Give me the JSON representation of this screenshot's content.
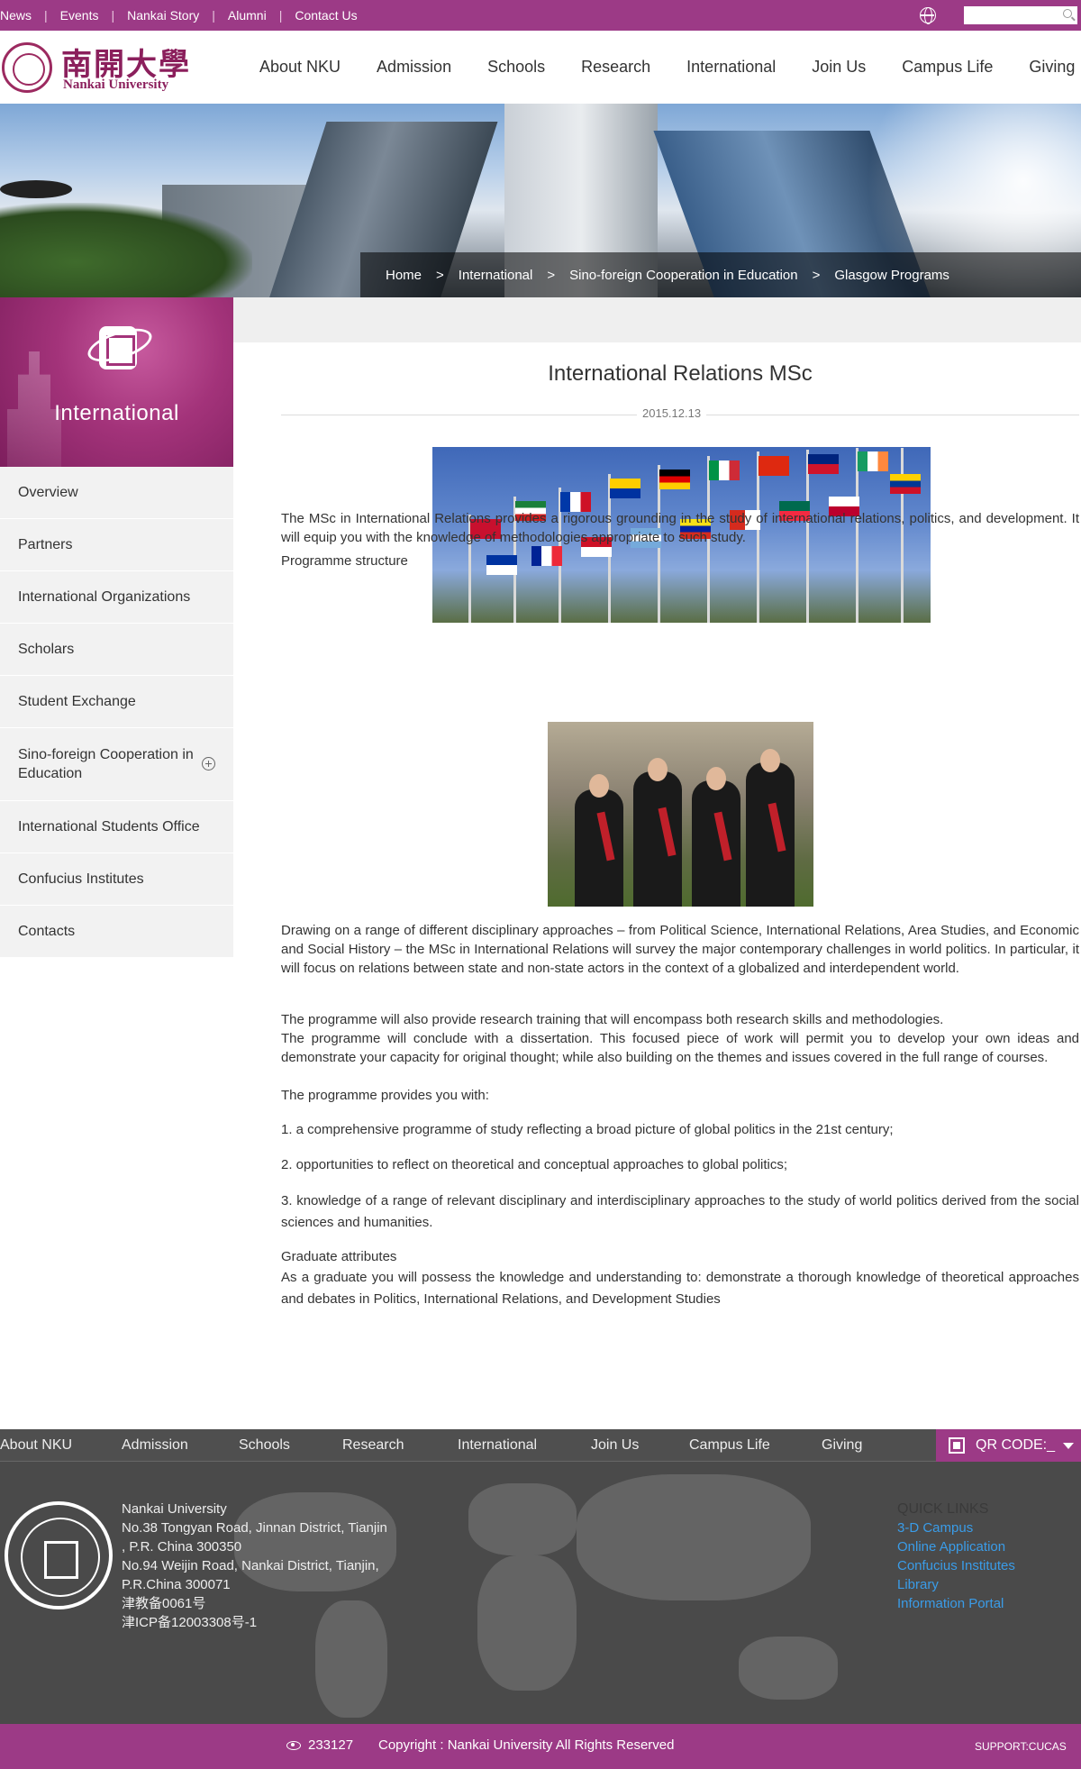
{
  "top_links": [
    "News",
    "Events",
    "Nankai Story",
    "Alumni",
    "Contact Us"
  ],
  "search": {
    "placeholder": ""
  },
  "logo": {
    "cn": "南開大學",
    "en": "Nankai University"
  },
  "main_nav": [
    "About NKU",
    "Admission",
    "Schools",
    "Research",
    "International",
    "Join Us",
    "Campus Life",
    "Giving"
  ],
  "breadcrumb": {
    "items": [
      "Home",
      "International",
      "Sino-foreign Cooperation in Education",
      "Glasgow Programs"
    ],
    "separator": ">"
  },
  "sidebar": {
    "title": "International",
    "items": [
      "Overview",
      "Partners",
      "International Organizations",
      "Scholars",
      "Student Exchange",
      "Sino-foreign Cooperation in Education",
      "International Students Office",
      "Confucius Institutes",
      "Contacts"
    ]
  },
  "article": {
    "title": "International Relations MSc",
    "date": "2015.12.13",
    "p1": "The MSc in International Relations provides a rigorous grounding in the study of international relations, politics, and development. It will equip you with the knowledge of methodologies appropriate to such study.",
    "p2": "Programme structure",
    "p3": "Drawing on a range of different disciplinary approaches – from Political Science, International Relations, Area Studies, and Economic and Social History – the MSc in International Relations will survey the major contemporary challenges in world politics.  In particular, it will focus on relations between state and non-state actors in the context of a globalized and interdependent world.",
    "p4a": "The programme will also provide research training that will encompass both research skills and methodologies.",
    "p4b": "The programme will conclude with a dissertation. This focused piece of work will permit you to develop your own ideas and demonstrate your capacity for original thought; while also building on the themes and issues covered in the full range of courses.",
    "p4c": "The programme provides you with:",
    "l1": "1. a comprehensive programme of study reflecting a broad picture of global politics in the 21st century;",
    "l2": "2. opportunities to reflect on theoretical and conceptual approaches to global politics;",
    "l3": "3. knowledge of a range of relevant disciplinary and interdisciplinary approaches to the study of world politics derived from the social sciences and humanities.",
    "ga_title": "Graduate attributes",
    "ga_text": "As a graduate you will possess the knowledge and understanding to: demonstrate a thorough knowledge of theoretical approaches and debates in Politics, International Relations, and Development Studies"
  },
  "footer_nav": [
    "About NKU",
    "Admission",
    "Schools",
    "Research",
    "International",
    "Join Us",
    "Campus Life",
    "Giving"
  ],
  "qr_label": "QR CODE:_",
  "address": {
    "name": "Nankai University",
    "line1": "No.38 Tongyan Road, Jinnan District, Tianjin",
    "line2": ", P.R. China 300350",
    "line3": "No.94 Weijin Road,  Nankai District, Tianjin,",
    "line4": "P.R.China  300071",
    "line5": "津教备0061号",
    "line6": "津ICP备12003308号-1"
  },
  "quick_links": {
    "title": "QUICK LINKS",
    "items": [
      "3-D Campus",
      "Online Application",
      "Confucius Institutes",
      "Library",
      "Information Portal"
    ]
  },
  "bottom_bar": {
    "count": "233127",
    "copyright": "Copyright : Nankai University All Rights Reserved",
    "support": "SUPPORT:CUCAS"
  },
  "colors": {
    "brand": "#9c3a86",
    "link": "#3a9ce8"
  }
}
